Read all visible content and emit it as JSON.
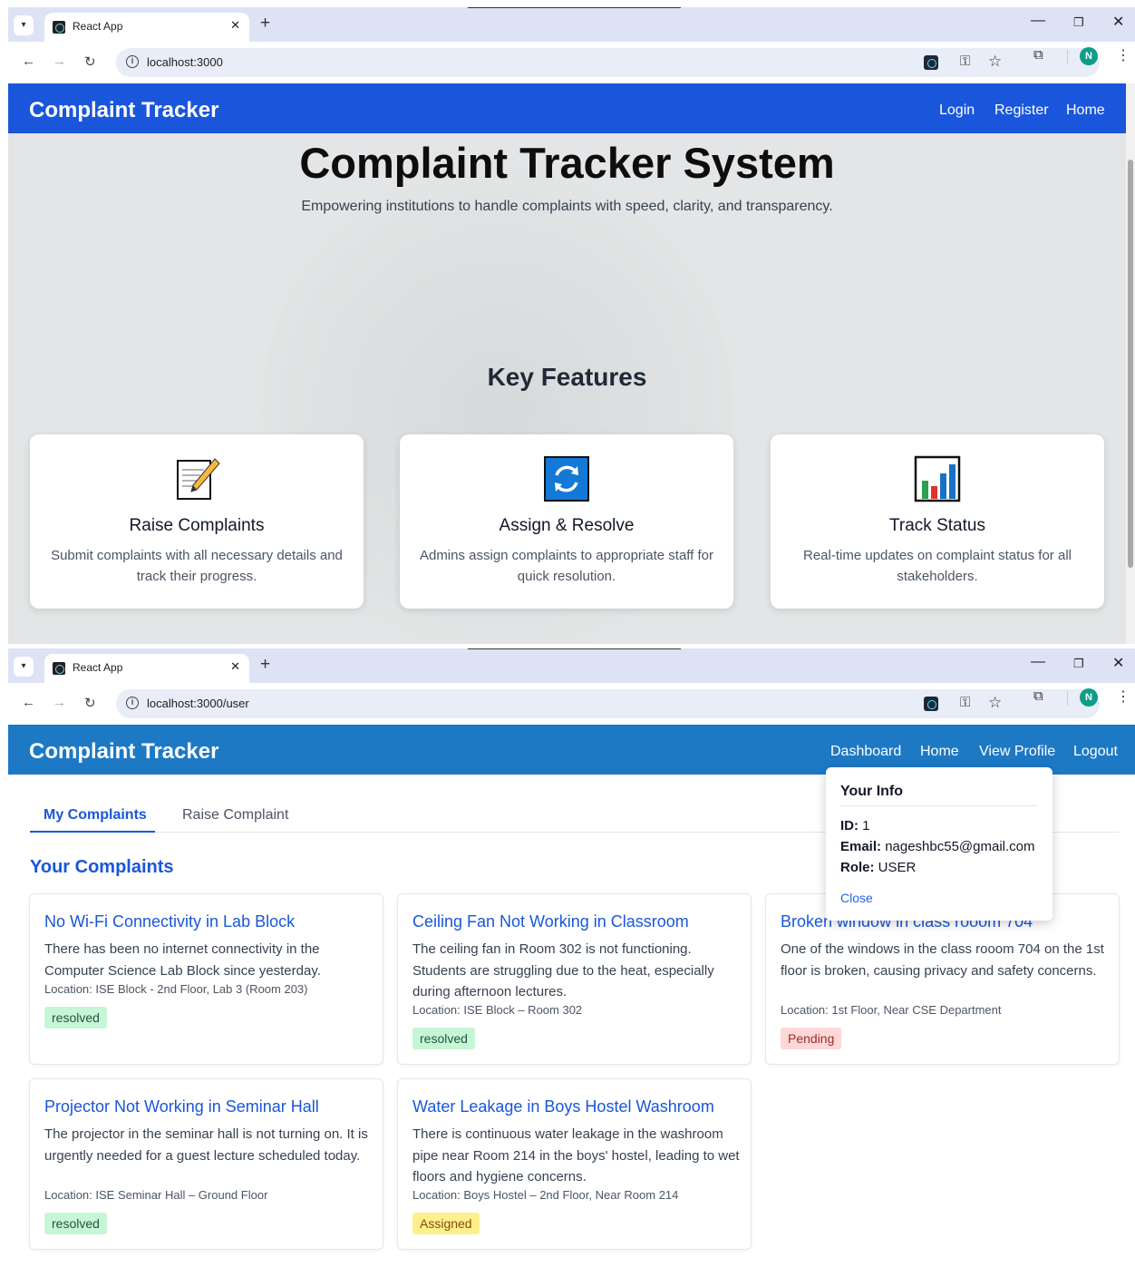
{
  "screens": [
    {
      "browser": {
        "tab_title": "React App",
        "url": "localhost:3000",
        "avatar_letter": "N"
      },
      "navbar": {
        "brand": "Complaint Tracker",
        "links": [
          "Login",
          "Register",
          "Home"
        ],
        "color": "#1a56db"
      },
      "hero": {
        "title": "Complaint Tracker System",
        "subtitle": "Empowering institutions to handle complaints with speed, clarity, and transparency."
      },
      "features": {
        "title": "Key Features",
        "items": [
          {
            "icon": "memo-icon",
            "title": "Raise Complaints",
            "desc": "Submit complaints with all necessary details and track their progress."
          },
          {
            "icon": "refresh-icon",
            "title": "Assign & Resolve",
            "desc": "Admins assign complaints to appropriate staff for quick resolution."
          },
          {
            "icon": "bar-chart-icon",
            "title": "Track Status",
            "desc": "Real-time updates on complaint status for all stakeholders."
          }
        ]
      }
    },
    {
      "browser": {
        "tab_title": "React App",
        "url": "localhost:3000/user",
        "avatar_letter": "N"
      },
      "navbar": {
        "brand": "Complaint Tracker",
        "links": [
          "Dashboard",
          "Home",
          "View Profile",
          "Logout"
        ],
        "color": "#1d79c4"
      },
      "tabs": [
        "My Complaints",
        "Raise Complaint"
      ],
      "section_title": "Your Complaints",
      "complaints": [
        {
          "title": "No Wi-Fi Connectivity in Lab Block",
          "desc": "There has been no internet connectivity in the Computer Science Lab Block since yesterday.",
          "location": "Location: ISE Block - 2nd Floor, Lab 3 (Room 203)",
          "status": "resolved"
        },
        {
          "title": "Ceiling Fan Not Working in Classroom",
          "desc": "The ceiling fan in Room 302 is not functioning. Students are struggling due to the heat, especially during afternoon lectures.",
          "location": "Location: ISE Block – Room 302",
          "status": "resolved"
        },
        {
          "title": "Broken window in class rooom 704",
          "desc": "One of the windows in the class rooom 704 on the 1st floor is broken, causing privacy and safety concerns.",
          "location": "Location: 1st Floor, Near CSE Department",
          "status": "Pending"
        },
        {
          "title": "Projector Not Working in Seminar Hall",
          "desc": "The projector in the seminar hall is not turning on. It is urgently needed for a guest lecture scheduled today.",
          "location": "Location: ISE Seminar Hall – Ground Floor",
          "status": "resolved"
        },
        {
          "title": "Water Leakage in Boys Hostel Washroom",
          "desc": "There is continuous water leakage in the washroom pipe near Room 214 in the boys' hostel, leading to wet floors and hygiene concerns.",
          "location": "Location: Boys Hostel – 2nd Floor, Near Room 214",
          "status": "Assigned"
        }
      ],
      "profile_popup": {
        "title": "Your Info",
        "id_label": "ID:",
        "id_value": "1",
        "email_label": "Email:",
        "email_value": "nageshbc55@gmail.com",
        "role_label": "Role:",
        "role_value": "USER",
        "close_label": "Close"
      }
    }
  ]
}
